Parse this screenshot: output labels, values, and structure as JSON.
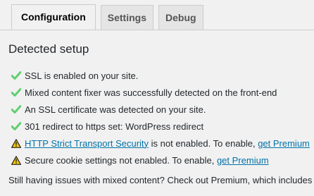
{
  "tabs": [
    {
      "label": "Configuration",
      "active": true
    },
    {
      "label": "Settings",
      "active": false
    },
    {
      "label": "Debug",
      "active": false
    }
  ],
  "heading": "Detected setup",
  "items": [
    {
      "status": "success",
      "icon": "checkmark-icon",
      "color": "#61ce70",
      "text": "SSL is enabled on your site."
    },
    {
      "status": "success",
      "icon": "checkmark-icon",
      "color": "#61ce70",
      "text": "Mixed content fixer was successfully detected on the front-end"
    },
    {
      "status": "success",
      "icon": "checkmark-icon",
      "color": "#61ce70",
      "text": "An SSL certificate was detected on your site."
    },
    {
      "status": "success",
      "icon": "checkmark-icon",
      "color": "#61ce70",
      "text": "301 redirect to https set: WordPress redirect"
    },
    {
      "status": "warning",
      "icon": "warning-icon",
      "color": "#f1c40f",
      "link1": "HTTP Strict Transport Security",
      "text": " is not enabled. To enable, ",
      "link2": "get Premium"
    },
    {
      "status": "warning",
      "icon": "warning-icon",
      "color": "#f1c40f",
      "text": "Secure cookie settings not enabled. To enable, ",
      "link2": "get Premium"
    }
  ],
  "footer": "Still having issues with mixed content? Check out Premium, which includes a"
}
